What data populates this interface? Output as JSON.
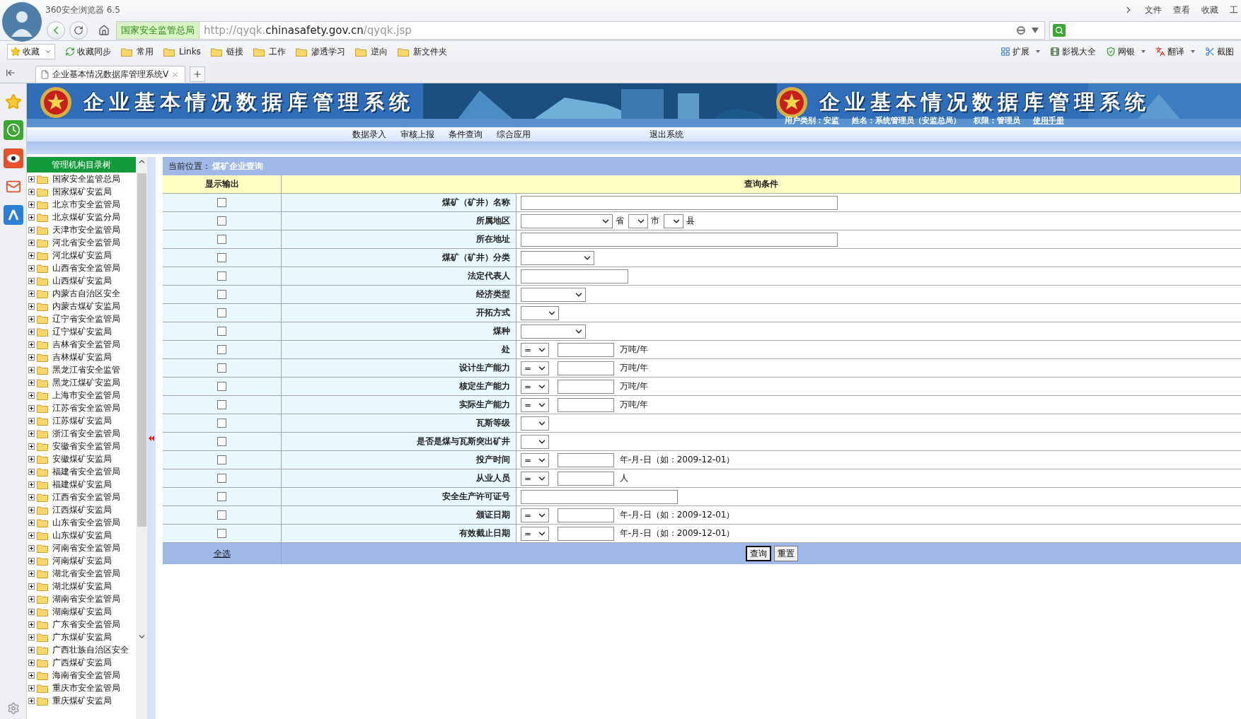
{
  "browser": {
    "title": "360安全浏览器 6.5",
    "menu": [
      "文件",
      "查看",
      "收藏",
      "工"
    ],
    "site_label": "国家安全监管总局",
    "url": "http://qyqk.**chinasafety.gov.cn**/qyqk.jsp",
    "bookmarks_left": [
      {
        "label": "收藏",
        "kind": "favorites"
      },
      {
        "label": "收藏同步",
        "kind": "sync"
      },
      {
        "label": "常用",
        "kind": "folder"
      },
      {
        "label": "Links",
        "kind": "folder"
      },
      {
        "label": "链接",
        "kind": "folder"
      },
      {
        "label": "工作",
        "kind": "folder"
      },
      {
        "label": "渗透学习",
        "kind": "folder"
      },
      {
        "label": "逆向",
        "kind": "folder"
      },
      {
        "label": "新文件夹",
        "kind": "folder"
      }
    ],
    "bookmarks_right": [
      {
        "label": "扩展",
        "kind": "extensions",
        "menu": true
      },
      {
        "label": "影视大全",
        "kind": "film",
        "menu": false
      },
      {
        "label": "网银",
        "kind": "bank",
        "menu": true
      },
      {
        "label": "翻译",
        "kind": "translate",
        "menu": true
      },
      {
        "label": "截图",
        "kind": "screenshot",
        "menu": false
      }
    ],
    "tabs": [
      {
        "label": "企业基本情况数据库管理系统V",
        "selected": true
      }
    ]
  },
  "banner": {
    "titles": [
      "企业基本情况数据库管理系统",
      "企业基本情况数据库管理系统"
    ],
    "user_type": "用户类别：安监",
    "user_name": "姓名：系统管理员（安监总局）",
    "role": "权限：管理员",
    "manual_link": "使用手册"
  },
  "nav": [
    {
      "label": "数据录入",
      "kind": "menu"
    },
    {
      "label": "审核上报",
      "kind": "menu"
    },
    {
      "label": "条件查询",
      "kind": "menu"
    },
    {
      "label": "综合应用",
      "kind": "menu"
    },
    {
      "label": "退出系统",
      "kind": "exit"
    }
  ],
  "tree": {
    "title": "管理机构目录树",
    "items": [
      {
        "label": "国家安全监管总局",
        "expanded": false
      },
      {
        "label": "国家煤矿安监局",
        "expanded": false
      },
      {
        "label": "北京市安全监管局",
        "expanded": false
      },
      {
        "label": "北京煤矿安监分局",
        "expanded": false
      },
      {
        "label": "天津市安全监管局",
        "expanded": false
      },
      {
        "label": "河北省安全监管局",
        "expanded": false
      },
      {
        "label": "河北煤矿安监局",
        "expanded": false
      },
      {
        "label": "山西省安全监管局",
        "expanded": false
      },
      {
        "label": "山西煤矿安监局",
        "expanded": false
      },
      {
        "label": "内蒙古自治区安全",
        "expanded": false
      },
      {
        "label": "内蒙古煤矿安监局",
        "expanded": false
      },
      {
        "label": "辽宁省安全监管局",
        "expanded": false
      },
      {
        "label": "辽宁煤矿安监局",
        "expanded": false
      },
      {
        "label": "吉林省安全监管局",
        "expanded": false
      },
      {
        "label": "吉林煤矿安监局",
        "expanded": false
      },
      {
        "label": "黑龙江省安全监管",
        "expanded": false
      },
      {
        "label": "黑龙江煤矿安监局",
        "expanded": false
      },
      {
        "label": "上海市安全监管局",
        "expanded": false
      },
      {
        "label": "江苏省安全监管局",
        "expanded": false
      },
      {
        "label": "江苏煤矿安监局",
        "expanded": false
      },
      {
        "label": "浙江省安全监管局",
        "expanded": false
      },
      {
        "label": "安徽省安全监管局",
        "expanded": false
      },
      {
        "label": "安徽煤矿安监局",
        "expanded": false
      },
      {
        "label": "福建省安全监管局",
        "expanded": false
      },
      {
        "label": "福建煤矿安监局",
        "expanded": false
      },
      {
        "label": "江西省安全监管局",
        "expanded": false
      },
      {
        "label": "江西煤矿安监局",
        "expanded": false
      },
      {
        "label": "山东省安全监管局",
        "expanded": false
      },
      {
        "label": "山东煤矿安监局",
        "expanded": false
      },
      {
        "label": "河南省安全监管局",
        "expanded": false
      },
      {
        "label": "河南煤矿安监局",
        "expanded": false
      },
      {
        "label": "湖北省安全监管局",
        "expanded": false
      },
      {
        "label": "湖北煤矿安监局",
        "expanded": false
      },
      {
        "label": "湖南省安全监管局",
        "expanded": false
      },
      {
        "label": "湖南煤矿安监局",
        "expanded": false
      },
      {
        "label": "广东省安全监管局",
        "expanded": false
      },
      {
        "label": "广东煤矿安监局",
        "expanded": false
      },
      {
        "label": "广西壮族自治区安全",
        "expanded": false
      },
      {
        "label": "广西煤矿安监局",
        "expanded": false
      },
      {
        "label": "海南省安全监管局",
        "expanded": false
      },
      {
        "label": "重庆市安全监管局",
        "expanded": false
      },
      {
        "label": "重庆煤矿安监局",
        "expanded": false
      }
    ]
  },
  "breadcrumb": {
    "label": "当前位置：",
    "current": "煤矿企业查询"
  },
  "form": {
    "columns": [
      "显示输出",
      "查询条件"
    ],
    "rows": [
      {
        "label": "煤矿（矿井）名称",
        "checked": false,
        "kind": "long_text"
      },
      {
        "label": "所属地区",
        "checked": false,
        "kind": "region",
        "units": [
          "省",
          "市",
          "县"
        ]
      },
      {
        "label": "所在地址",
        "checked": false,
        "kind": "long_text"
      },
      {
        "label": "煤矿（矿井）分类",
        "checked": false,
        "kind": "wide_select"
      },
      {
        "label": "法定代表人",
        "checked": false,
        "kind": "short_text"
      },
      {
        "label": "经济类型",
        "checked": false,
        "kind": "medium_select"
      },
      {
        "label": "开拓方式",
        "checked": false,
        "kind": "narrow_select"
      },
      {
        "label": "煤种",
        "checked": false,
        "kind": "medium_select"
      },
      {
        "label": "处",
        "checked": false,
        "kind": "compare",
        "operator": "=",
        "unit": "万吨/年"
      },
      {
        "label": "设计生产能力",
        "checked": false,
        "kind": "compare",
        "operator": "=",
        "unit": "万吨/年"
      },
      {
        "label": "核定生产能力",
        "checked": false,
        "kind": "compare",
        "operator": "=",
        "unit": "万吨/年"
      },
      {
        "label": "实际生产能力",
        "checked": false,
        "kind": "compare",
        "operator": "=",
        "unit": "万吨/年"
      },
      {
        "label": "瓦斯等级",
        "checked": false,
        "kind": "tiny_select"
      },
      {
        "label": "是否是煤与瓦斯突出矿井",
        "checked": false,
        "kind": "tiny_select"
      },
      {
        "label": "投产时间",
        "checked": false,
        "kind": "compare",
        "operator": "=",
        "unit": "年-月-日（如：2009-12-01）"
      },
      {
        "label": "从业人员",
        "checked": false,
        "kind": "compare",
        "operator": "=",
        "unit": "人"
      },
      {
        "label": "安全生产许可证号",
        "checked": false,
        "kind": "medium_text"
      },
      {
        "label": "颁证日期",
        "checked": false,
        "kind": "compare",
        "operator": "=",
        "unit": "年-月-日（如：2009-12-01）"
      },
      {
        "label": "有效截止日期",
        "checked": false,
        "kind": "compare",
        "operator": "=",
        "unit": "年-月-日（如：2009-12-01）"
      }
    ],
    "select_all": "全选",
    "buttons": [
      {
        "label": "查询",
        "selected": true
      },
      {
        "label": "重置",
        "selected": false
      }
    ]
  }
}
